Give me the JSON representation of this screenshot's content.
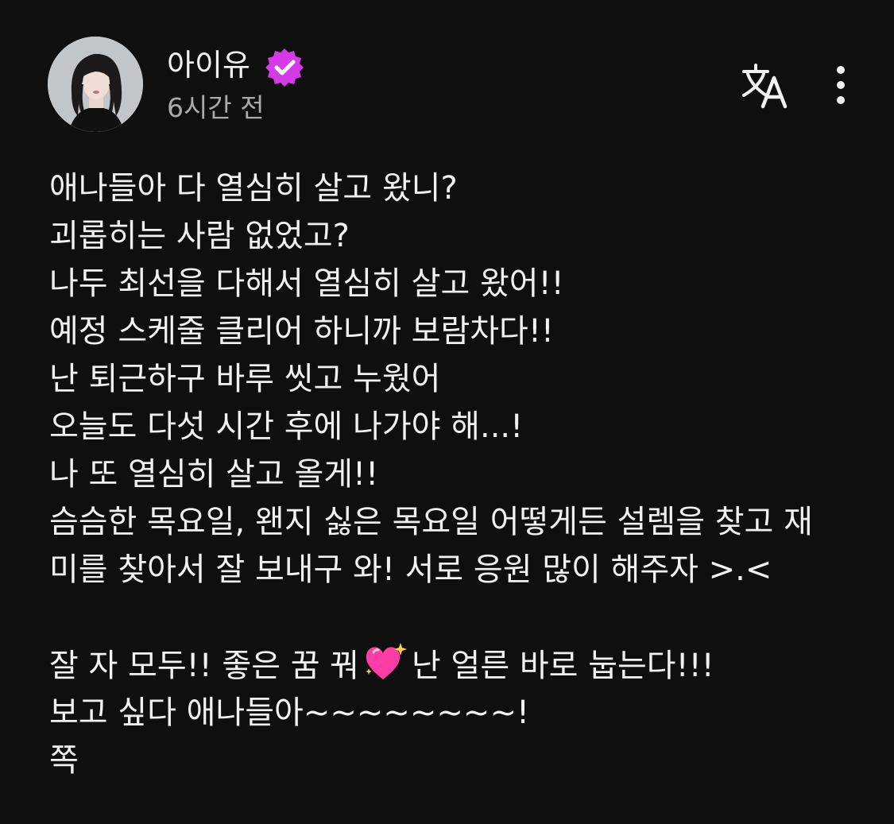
{
  "author": {
    "name": "아이유",
    "time": "6시간 전"
  },
  "icons": {
    "verified": "verified-badge-icon",
    "translate": "translate-icon",
    "more": "more-vertical-icon",
    "heart": "sparkling-heart-emoji"
  },
  "colors": {
    "background": "#0f0f0f",
    "text": "#f1f1f1",
    "secondary_text": "#aaaaaa",
    "badge": "#d63ae6",
    "heart": "#ff3ea5"
  },
  "body": {
    "lines": [
      "애나들아 다 열심히 살고 왔니?",
      "괴롭히는 사람 없었고?",
      "나두 최선을 다해서 열심히 살고 왔어!!",
      "예정 스케줄 클리어 하니까 보람차다!!",
      "난 퇴근하구 바루 씻고 누웠어",
      "오늘도 다섯 시간 후에 나가야 해...!",
      "나 또 열심히 살고 올게!!",
      "슴슴한 목요일, 왠지 싫은 목요일 어떻게든 설렘을 찾고 재",
      "미를 찾아서 잘 보내구 와! 서로 응원 많이 해주자 >.<"
    ],
    "line10_before": "잘 자 모두!! 좋은 꿈 꿔",
    "line10_after": "난 얼른 바로 눕는다!!!",
    "line11": "보고 싶다 애나들아~~~~~~~~!",
    "line12": "쪽"
  }
}
